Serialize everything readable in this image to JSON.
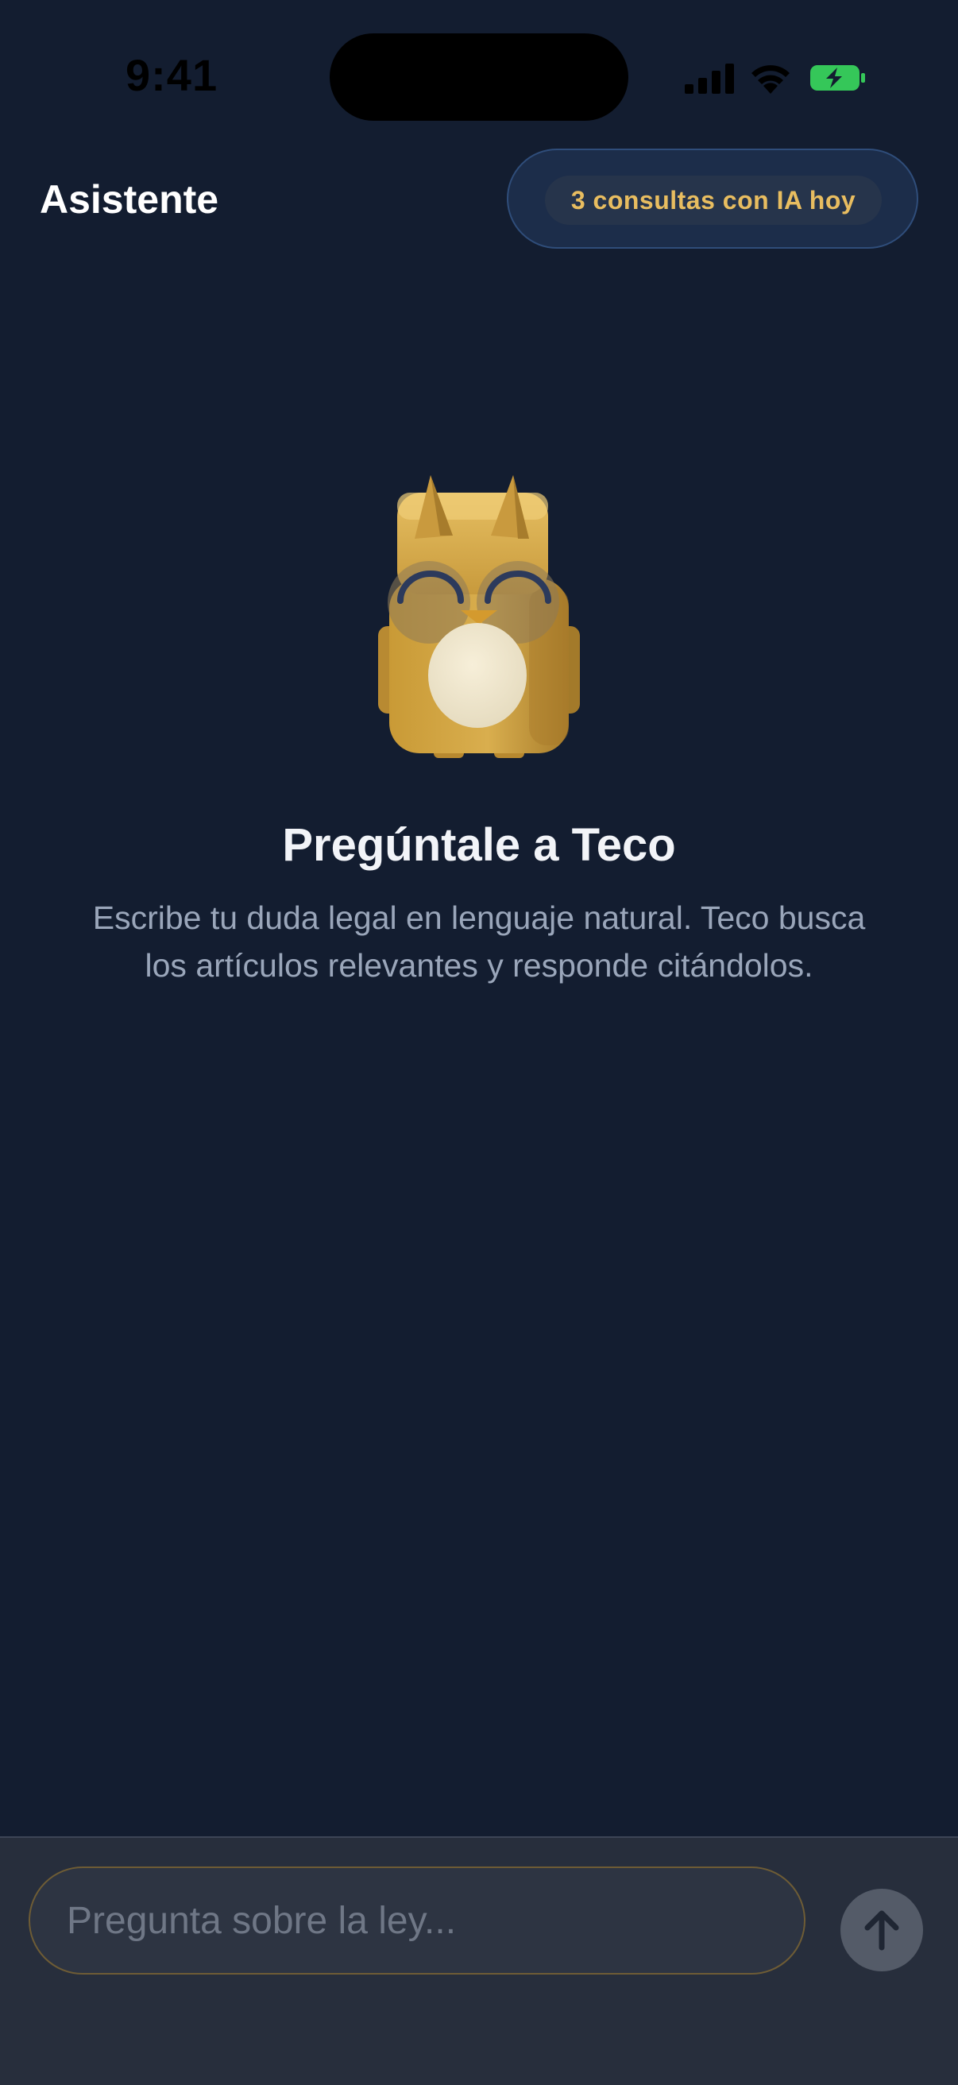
{
  "status_bar": {
    "time": "9:41",
    "icons": [
      "cellular-signal-icon",
      "wifi-icon",
      "battery-charging-icon"
    ]
  },
  "header": {
    "title": "Asistente",
    "quota_badge": "3 consultas con IA hoy"
  },
  "empty_state": {
    "mascot": "owl-mascot-icon",
    "title": "Pregúntale a Teco",
    "description": "Escribe tu duda legal en lenguaje natural. Teco busca los artículos relevantes y responde citándolos."
  },
  "composer": {
    "placeholder": "Pregunta sobre la ley...",
    "value": "",
    "send_icon": "arrow-up-icon"
  },
  "colors": {
    "background": "#131d30",
    "accent_gold": "#e8bd60",
    "battery_green": "#35c759",
    "composer_background": "#272e3c"
  }
}
